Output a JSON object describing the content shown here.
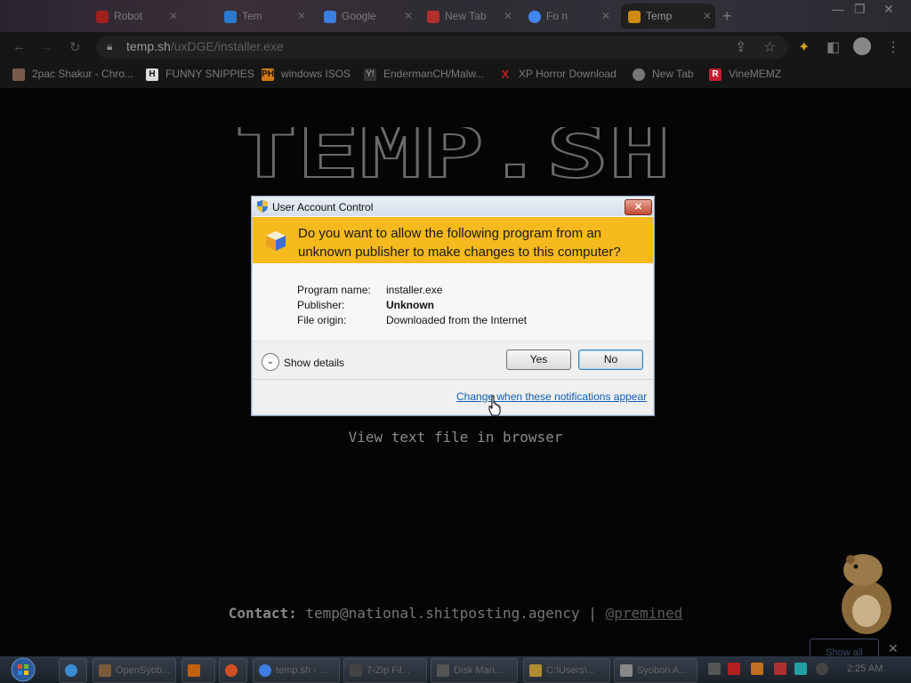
{
  "browser": {
    "tabs": [
      {
        "label": "",
        "color": "#6b3a7a"
      },
      {
        "label": "Robot",
        "color": "#a02020"
      },
      {
        "label": "Tem",
        "color": "#2a7bd0"
      },
      {
        "label": "Google",
        "color": "#3b7de0"
      },
      {
        "label": "New Tab",
        "color": "#b03030"
      },
      {
        "label": "Fo n",
        "color": "#4285f4"
      },
      {
        "label": "Temp",
        "color": "#d08a10"
      }
    ],
    "url_host": "temp.sh",
    "url_path": "/uxDGE/installer.exe",
    "bookmarks": [
      {
        "label": "2pac Shakur - Chro...",
        "icon_color": "#7a5a4a",
        "icon_text": ""
      },
      {
        "label": "FUNNY SNIPPIES",
        "icon_color": "#dddddd",
        "icon_text": "H"
      },
      {
        "label": "windows ISOS",
        "icon_color": "#d07a10",
        "icon_text": "PH"
      },
      {
        "label": "EndermanCH/Malw...",
        "icon_color": "#555555",
        "icon_text": "Y!"
      },
      {
        "label": "XP Horror Download",
        "icon_color": "#c02020",
        "icon_text": "X"
      },
      {
        "label": "New Tab",
        "icon_color": "#777777",
        "icon_text": ""
      },
      {
        "label": "VineMEMZ",
        "icon_color": "#c02030",
        "icon_text": "R"
      }
    ]
  },
  "page": {
    "logo_text": "TEMP.SH",
    "view_link": "View text file in browser",
    "contact_label": "Contact:",
    "contact_email": "temp@national.shitposting.agency",
    "contact_sep": "|",
    "contact_handle": "@premined",
    "show_all": "Show all"
  },
  "uac": {
    "title": "User Account Control",
    "question": "Do you want to allow the following program from an unknown publisher to make changes to this computer?",
    "fields": [
      {
        "label": "Program name:",
        "value": "installer.exe",
        "bold": false
      },
      {
        "label": "Publisher:",
        "value": "Unknown",
        "bold": true
      },
      {
        "label": "File origin:",
        "value": "Downloaded from the Internet",
        "bold": false
      }
    ],
    "show_details": "Show details",
    "yes": "Yes",
    "no": "No",
    "change_link": "Change when these notifications appear",
    "banner_color": "#f6b91e"
  },
  "taskbar": {
    "items": [
      {
        "label": "OpenSyob...",
        "color": "#7a5a3a"
      },
      {
        "label": "",
        "color": "#c06010"
      },
      {
        "label": "",
        "color": "#d05020"
      },
      {
        "label": "temp.sh - ...",
        "color": "#3b7de0"
      },
      {
        "label": "7-Zip Fil...",
        "color": "#444444"
      },
      {
        "label": "Disk Man...",
        "color": "#555555"
      },
      {
        "label": "C:\\Users\\...",
        "color": "#b08a30"
      },
      {
        "label": "Syobon A...",
        "color": "#888888"
      }
    ],
    "clock": "2:25 AM"
  }
}
